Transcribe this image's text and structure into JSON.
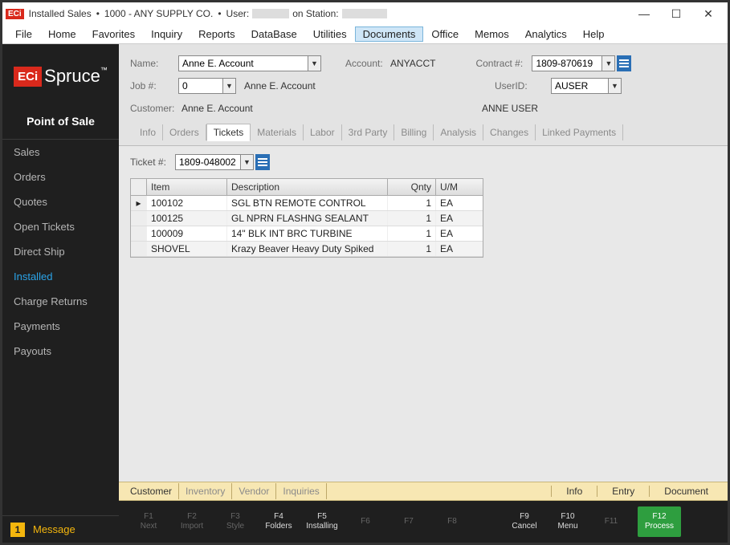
{
  "titlebar": {
    "app": "Installed Sales",
    "company": "1000 - ANY SUPPLY CO.",
    "user_prefix": "User:",
    "station_prefix": "on Station:"
  },
  "menu": [
    "File",
    "Home",
    "Favorites",
    "Inquiry",
    "Reports",
    "DataBase",
    "Utilities",
    "Documents",
    "Office",
    "Memos",
    "Analytics",
    "Help"
  ],
  "menu_active": "Documents",
  "sidebar": {
    "title": "Point of Sale",
    "items": [
      "Sales",
      "Orders",
      "Quotes",
      "Open Tickets",
      "Direct Ship",
      "Installed",
      "Charge Returns",
      "Payments",
      "Payouts"
    ],
    "active": "Installed",
    "message_count": "1",
    "message_label": "Message"
  },
  "form": {
    "name_label": "Name:",
    "name_value": "Anne E. Account",
    "account_label": "Account:",
    "account_value": "ANYACCT",
    "contract_label": "Contract #:",
    "contract_value": "1809-870619",
    "job_label": "Job #:",
    "job_value": "0",
    "job_text": "Anne E. Account",
    "userid_label": "UserID:",
    "userid_value": "AUSER",
    "customer_label": "Customer:",
    "customer_value": "Anne E. Account",
    "user_full": "ANNE USER"
  },
  "tabs": [
    "Info",
    "Orders",
    "Tickets",
    "Materials",
    "Labor",
    "3rd Party",
    "Billing",
    "Analysis",
    "Changes",
    "Linked Payments"
  ],
  "tabs_active": "Tickets",
  "ticket": {
    "label": "Ticket #:",
    "value": "1809-048002",
    "columns": {
      "item": "Item",
      "desc": "Description",
      "qty": "Qnty",
      "um": "U/M"
    },
    "rows": [
      {
        "item": "100102",
        "desc": "SGL BTN REMOTE CONTROL",
        "qty": "1",
        "um": "EA",
        "current": true
      },
      {
        "item": "100125",
        "desc": "GL NPRN FLASHNG SEALANT",
        "qty": "1",
        "um": "EA"
      },
      {
        "item": "100009",
        "desc": "14\" BLK INT BRC TURBINE",
        "qty": "1",
        "um": "EA"
      },
      {
        "item": "SHOVEL",
        "desc": "Krazy Beaver Heavy Duty Spiked",
        "qty": "1",
        "um": "EA"
      }
    ]
  },
  "bottom_tabs": {
    "left": [
      "Customer",
      "Inventory",
      "Vendor",
      "Inquiries"
    ],
    "active": "Customer",
    "right": [
      "Info",
      "Entry",
      "Document"
    ]
  },
  "fkeys": [
    {
      "k": "F1",
      "l": "Next",
      "on": false
    },
    {
      "k": "F2",
      "l": "Import",
      "on": false
    },
    {
      "k": "F3",
      "l": "Style",
      "on": false
    },
    {
      "k": "F4",
      "l": "Folders",
      "on": true
    },
    {
      "k": "F5",
      "l": "Installing",
      "on": true
    },
    {
      "k": "F6",
      "l": "",
      "on": false
    },
    {
      "k": "F7",
      "l": "",
      "on": false
    },
    {
      "k": "F8",
      "l": "",
      "on": false
    },
    {
      "gap": true
    },
    {
      "k": "F9",
      "l": "Cancel",
      "on": true
    },
    {
      "k": "F10",
      "l": "Menu",
      "on": true
    },
    {
      "k": "F11",
      "l": "",
      "on": false
    },
    {
      "k": "F12",
      "l": "Process",
      "on": true,
      "process": true
    }
  ]
}
